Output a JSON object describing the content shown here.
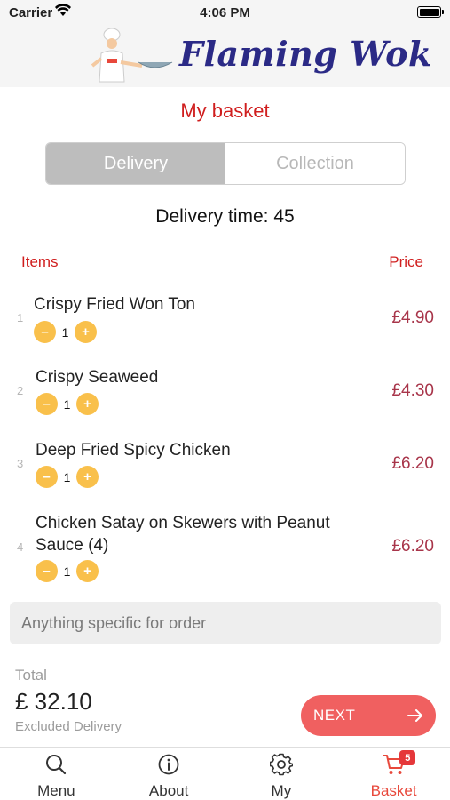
{
  "status_bar": {
    "carrier": "Carrier",
    "time": "4:06 PM"
  },
  "header": {
    "brand": "Flaming Wok"
  },
  "page_title": "My basket",
  "segment": {
    "options": [
      "Delivery",
      "Collection"
    ],
    "selected": "Delivery"
  },
  "delivery_time": "Delivery time: 45",
  "columns": {
    "items": "Items",
    "price": "Price"
  },
  "basket_items": [
    {
      "index": "1",
      "name": "Crispy Fried Won Ton",
      "qty": "1",
      "price": "£4.90"
    },
    {
      "index": "2",
      "name": "Crispy Seaweed",
      "qty": "1",
      "price": "£4.30"
    },
    {
      "index": "3",
      "name": "Deep Fried Spicy Chicken",
      "qty": "1",
      "price": "£6.20"
    },
    {
      "index": "4",
      "name": "Chicken Satay on Skewers with Peanut Sauce (4)",
      "qty": "1",
      "price": "£6.20"
    }
  ],
  "qty_controls": {
    "minus": "–",
    "plus": "+"
  },
  "note": {
    "placeholder": "Anything specific for order"
  },
  "total": {
    "label": "Total",
    "value": "£ 32.10",
    "note": "Excluded Delivery"
  },
  "next_button": {
    "label": "NEXT"
  },
  "tabbar": {
    "tabs": [
      {
        "label": "Menu",
        "icon": "search-icon"
      },
      {
        "label": "About",
        "icon": "info-icon"
      },
      {
        "label": "My",
        "icon": "gear-icon"
      },
      {
        "label": "Basket",
        "icon": "cart-icon",
        "badge": "5",
        "active": true
      }
    ]
  },
  "colors": {
    "accent_red": "#d01e1e",
    "price": "#a8354a",
    "qty_button": "#f9c04b",
    "next_button": "#f06060",
    "brand": "#2b2a86"
  }
}
